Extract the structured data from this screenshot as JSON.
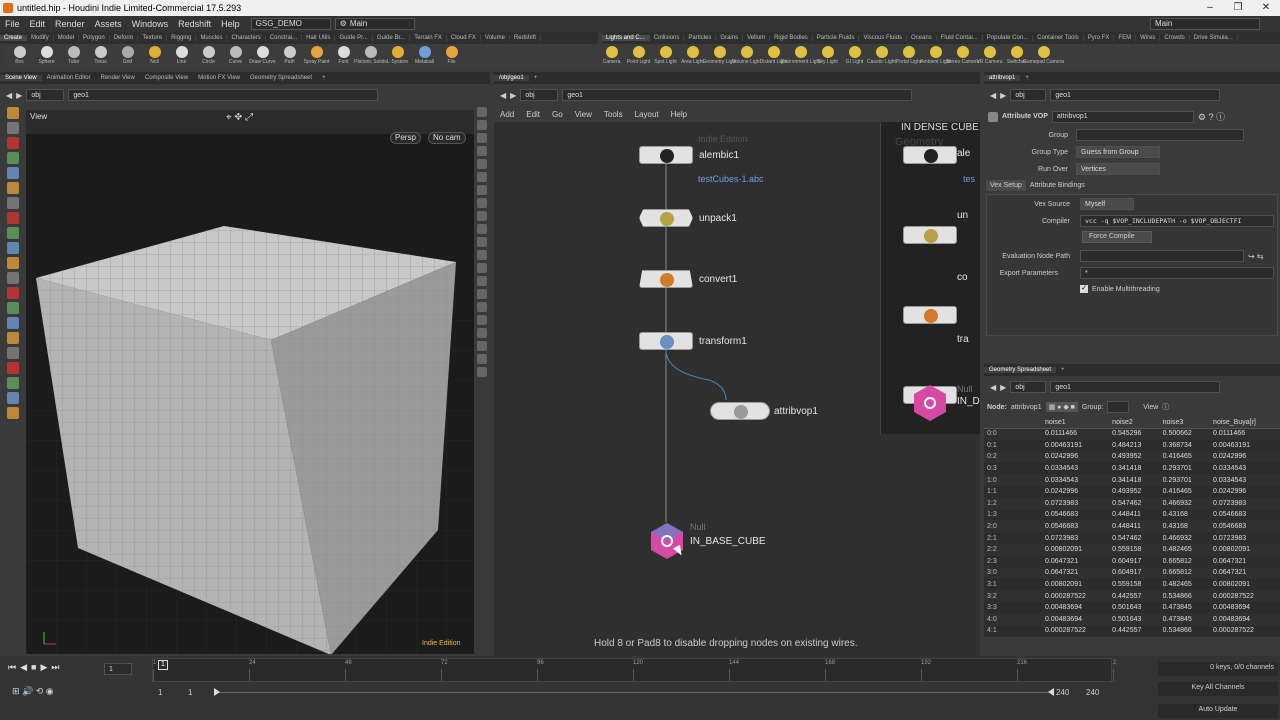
{
  "window": {
    "title": "untitled.hip - Houdini Indie Limited-Commercial 17.5.293"
  },
  "menu": {
    "items": [
      "File",
      "Edit",
      "Render",
      "Assets",
      "Windows",
      "Redshift",
      "Help"
    ],
    "desktop": "GSG_DEMO",
    "main_left": "Main",
    "main_right": "Main"
  },
  "shelf_left": {
    "tabs": [
      "Create",
      "Modify",
      "Model",
      "Polygon",
      "Deform",
      "Texture",
      "Rigging",
      "Muscles",
      "Characters",
      "Constrai...",
      "Hair Utils",
      "Guide Pr...",
      "Guide Br...",
      "Terrain FX",
      "Cloud FX",
      "Volume",
      "Redshift"
    ],
    "tools": [
      "Box",
      "Sphere",
      "Tube",
      "Torus",
      "Grid",
      "Null",
      "Line",
      "Circle",
      "Curve",
      "Draw Curve",
      "Path",
      "Spray Paint",
      "Font",
      "Platonic Solids",
      "L-System",
      "Metaball",
      "File"
    ]
  },
  "shelf_right": {
    "tabs": [
      "Lights and C...",
      "Collisions",
      "Particles",
      "Grains",
      "Vellum",
      "Rigid Bodies",
      "Particle Fluids",
      "Viscous Fluids",
      "Oceans",
      "Fluid Contai...",
      "Populate Con...",
      "Container Tools",
      "Pyro FX",
      "FEM",
      "Wires",
      "Crowds",
      "Drive Simula..."
    ],
    "tools": [
      "Camera",
      "Point Light",
      "Spot Light",
      "Area Light",
      "Geometry Light",
      "Volume Light",
      "Distant Light",
      "Environment Light",
      "Sky Light",
      "GI Light",
      "Caustic Light",
      "Portal Light",
      "Ambient Light",
      "Stereo Camera",
      "VR Camera",
      "Switcher",
      "Gamepad Camera"
    ]
  },
  "viewport": {
    "tabs": [
      "Scene View",
      "Animation Editor",
      "Render View",
      "Composite View",
      "Motion FX View",
      "Geometry Spreadsheet"
    ],
    "path": [
      "obj",
      "geo1"
    ],
    "title": "View",
    "camera_persp": "Persp",
    "camera_nocam": "No cam",
    "watermark": "Indie Edition"
  },
  "network": {
    "tab": "/obj/geo1",
    "path": [
      "obj",
      "geo1"
    ],
    "menu": [
      "Add",
      "Edit",
      "Go",
      "View",
      "Tools",
      "Layout",
      "Help"
    ],
    "nodes": [
      {
        "name": "alembic1",
        "sub": "testCubes-1.abc",
        "ghost": "Indie Edition"
      },
      {
        "name": "unpack1"
      },
      {
        "name": "convert1"
      },
      {
        "name": "transform1"
      },
      {
        "name": "attribvop1"
      },
      {
        "name": "IN_BASE_CUBE",
        "type": "Null"
      }
    ],
    "side_nodes": [
      "ale",
      "tes",
      "un",
      "co",
      "tra",
      "Null",
      "IN_D"
    ],
    "side_title": "IN DENSE CUBE",
    "side_ghost": "Geometry",
    "hint": "Hold 8 or Pad8 to disable dropping nodes on existing wires."
  },
  "params": {
    "tab": "attribvop1",
    "path": [
      "obj",
      "geo1"
    ],
    "node_type": "Attribute VOP",
    "node_name": "attribvop1",
    "group_label": "Group",
    "group_type_label": "Group Type",
    "group_type_value": "Guess from Group",
    "run_over_label": "Run Over",
    "run_over_value": "Vertices",
    "tabs": [
      "Vex Setup",
      "Attribute Bindings"
    ],
    "vex_source_label": "Vex Source",
    "vex_source_value": "Myself",
    "compiler_label": "Compiler",
    "compiler_value": "vcc -q $VOP_INCLUDEPATH -o $VOP_OBJECTFI",
    "force_compile": "Force Compile",
    "eval_path_label": "Evaluation Node Path",
    "export_label": "Export Parameters",
    "export_value": "*",
    "multithread": "Enable Multithreading"
  },
  "spreadsheet": {
    "tab": "Geometry Spreadsheet",
    "path": [
      "obj",
      "geo1"
    ],
    "node_label": "Node:",
    "node_value": "attribvop1",
    "group_label": "Group:",
    "view_label": "View",
    "columns": [
      "",
      "noise1",
      "noise2",
      "noise3",
      "noise_Buya[r]"
    ],
    "rows": [
      [
        "0:0",
        "0.0111466",
        "0.545296",
        "0.500662",
        "0.0111466"
      ],
      [
        "0:1",
        "0.00463191",
        "0.484213",
        "0.368734",
        "0.00463191"
      ],
      [
        "0:2",
        "0.0242996",
        "0.493952",
        "0.416465",
        "0.0242996"
      ],
      [
        "0:3",
        "0.0334543",
        "0.341418",
        "0.293701",
        "0.0334543"
      ],
      [
        "1:0",
        "0.0334543",
        "0.341418",
        "0.293701",
        "0.0334543"
      ],
      [
        "1:1",
        "0.0242996",
        "0.493952",
        "0.416465",
        "0.0242996"
      ],
      [
        "1:2",
        "0.0723983",
        "0.547462",
        "0.466932",
        "0.0723983"
      ],
      [
        "1:3",
        "0.0546683",
        "0.448411",
        "0.43168",
        "0.0546683"
      ],
      [
        "2:0",
        "0.0546683",
        "0.448411",
        "0.43168",
        "0.0546683"
      ],
      [
        "2:1",
        "0.0723983",
        "0.547462",
        "0.466932",
        "0.0723983"
      ],
      [
        "2:2",
        "0.00802091",
        "0.559158",
        "0.482465",
        "0.00802091"
      ],
      [
        "2:3",
        "0.0647321",
        "0.604917",
        "0.665812",
        "0.0647321"
      ],
      [
        "3:0",
        "0.0647321",
        "0.604917",
        "0.665812",
        "0.0647321"
      ],
      [
        "3:1",
        "0.00802091",
        "0.559158",
        "0.482465",
        "0.00802091"
      ],
      [
        "3:2",
        "0.000287522",
        "0.442557",
        "0.534866",
        "0.000287522"
      ],
      [
        "3:3",
        "0.00483694",
        "0.501643",
        "0.473845",
        "0.00483694"
      ],
      [
        "4:0",
        "0.00483694",
        "0.501643",
        "0.473845",
        "0.00483694"
      ],
      [
        "4:1",
        "0.000287522",
        "0.442557",
        "0.534866",
        "0.000287522"
      ]
    ]
  },
  "timeline": {
    "frame": "1",
    "ticks": [
      "1",
      "24",
      "48",
      "72",
      "96",
      "120",
      "144",
      "168",
      "192",
      "216",
      "2"
    ],
    "start": "1",
    "start2": "1",
    "end": "240",
    "end2": "240",
    "keys_info": "0 keys, 0/0 channels",
    "key_all": "Key All Channels",
    "auto_update": "Auto Update"
  },
  "colors": {
    "accent": "#e8a33a",
    "node_bg": "#e2e2e2",
    "null_node": "#d64aa6",
    "viewport_bg": "#1e1e1e"
  }
}
